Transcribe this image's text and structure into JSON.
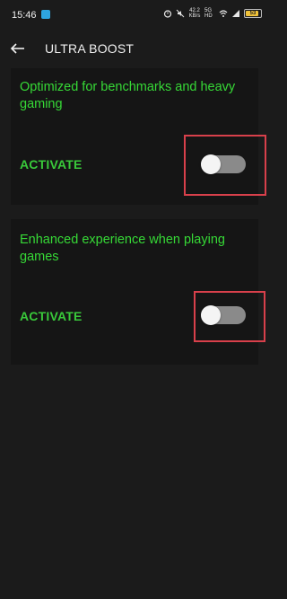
{
  "status_bar": {
    "time": "15:46",
    "net_speed_value": "42.2",
    "net_speed_unit": "KB/s",
    "signal_text": "5G HD",
    "battery_text": "53",
    "icons": [
      "telegram-icon",
      "alarm-icon",
      "mute-icon",
      "wifi-icon",
      "signal-icon",
      "battery-icon"
    ]
  },
  "header": {
    "back_icon": "arrow-left",
    "title": "ULTRA BOOST"
  },
  "cards": [
    {
      "description": "Optimized for benchmarks and heavy gaming",
      "activate_label": "ACTIVATE",
      "toggle_on": false
    },
    {
      "description": "Enhanced experience when playing games",
      "activate_label": "ACTIVATE",
      "toggle_on": false
    }
  ],
  "colors": {
    "background": "#1b1b1b",
    "card": "#151515",
    "accent_green": "#39c93a",
    "highlight_red": "#d8404b",
    "toggle_off": "#8a8a8a"
  }
}
